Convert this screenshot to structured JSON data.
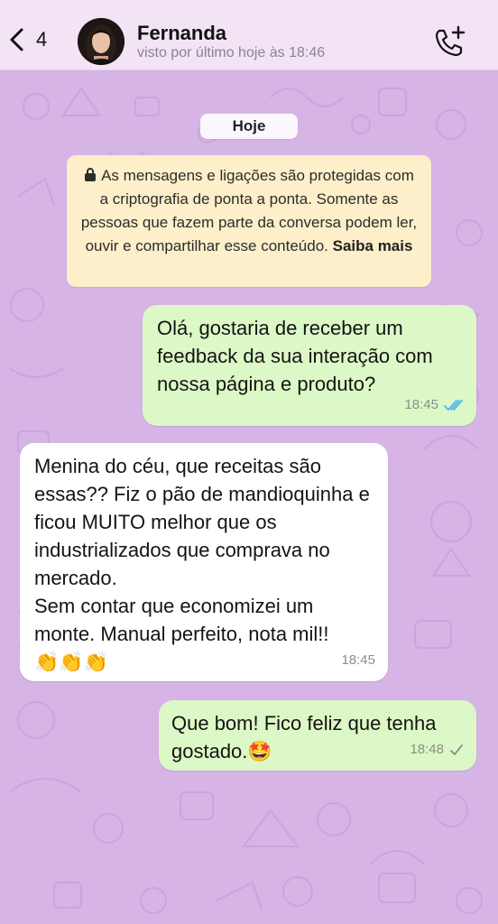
{
  "header": {
    "back_count": "4",
    "contact_name": "Fernanda",
    "last_seen": "visto por último hoje às 18:46"
  },
  "chat": {
    "date_label": "Hoje",
    "system_message": {
      "text": "As mensagens e ligações são protegidas com a criptografia de ponta a ponta. Somente as pessoas que fazem parte da conversa podem ler, ouvir e compartilhar esse conteúdo.",
      "link": "Saiba mais"
    },
    "messages": [
      {
        "direction": "out",
        "text": "Olá, gostaria de receber um feedback da sua interação com nossa página e produto?",
        "time": "18:45",
        "status": "read"
      },
      {
        "direction": "in",
        "text": "Menina do céu, que receitas são essas?? Fiz o pão de mandioquinha e ficou MUITO melhor que os industrializados que comprava no mercado.\nSem contar que economizei um monte. Manual perfeito, nota mil!!",
        "emoji": "👏👏👏",
        "time": "18:45"
      },
      {
        "direction": "out",
        "text": "Que bom! Fico feliz que tenha gostado.",
        "emoji": "🤩",
        "time": "18:48",
        "status": "sent"
      }
    ]
  },
  "colors": {
    "wallpaper": "#d6b4e6",
    "header_bg": "#f2e4f4",
    "outgoing_bubble": "#dcf8c6",
    "incoming_bubble": "#ffffff",
    "system_bubble": "#fcefc9",
    "read_ticks": "#4fb6ec"
  }
}
